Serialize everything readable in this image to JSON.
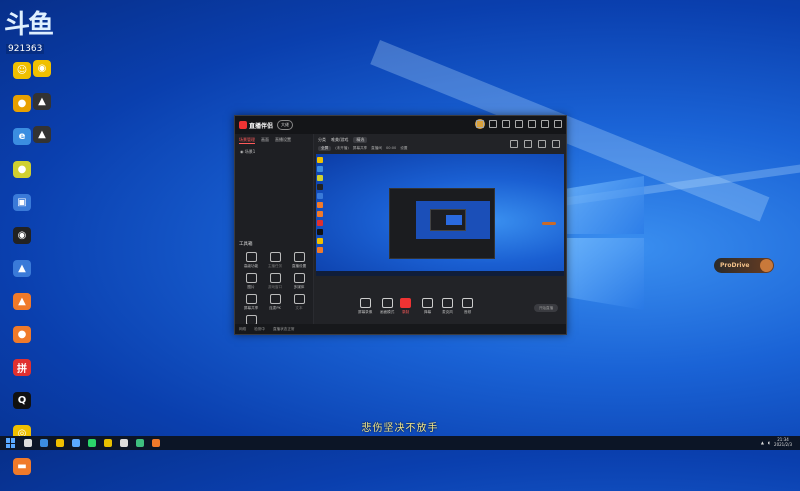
{
  "desktop": {
    "top_logo_text": "斗鱼",
    "top_logo_number": "921363",
    "icons": [
      {
        "label": "",
        "color": "#f0c000",
        "glyph": "☺"
      },
      {
        "label": "",
        "color": "#e8a000",
        "glyph": "●"
      },
      {
        "label": "",
        "color": "#3b8de0",
        "glyph": "e"
      },
      {
        "label": "",
        "color": "#d0d030",
        "glyph": "●"
      },
      {
        "label": "",
        "color": "#3a7ad8",
        "glyph": "▣"
      },
      {
        "label": "",
        "color": "#222222",
        "glyph": "◉"
      },
      {
        "label": "",
        "color": "#3a7ad8",
        "glyph": "▲"
      },
      {
        "label": "",
        "color": "#f07a2a",
        "glyph": "▲"
      },
      {
        "label": "",
        "color": "#f07a2a",
        "glyph": "●"
      },
      {
        "label": "",
        "color": "#e03030",
        "glyph": "拼"
      },
      {
        "label": "",
        "color": "#111111",
        "glyph": "Q"
      },
      {
        "label": "",
        "color": "#f0c000",
        "glyph": "◎"
      },
      {
        "label": "",
        "color": "#f07a2a",
        "glyph": "▬"
      }
    ],
    "icons_col2": [
      {
        "label": "",
        "color": "#f0c000",
        "glyph": "◉"
      },
      {
        "label": "",
        "color": "#333333",
        "glyph": "▲"
      },
      {
        "label": "",
        "color": "#333333",
        "glyph": "▲"
      }
    ]
  },
  "app": {
    "title": "直播伴侣",
    "badge": "大佬",
    "left_tabs": [
      "场景管理",
      "画面",
      "直播设置"
    ],
    "scene": "场景1",
    "tool_title": "工具箱",
    "tools": [
      {
        "label": "高级功能",
        "dim": false
      },
      {
        "label": "主播任务",
        "dim": true
      },
      {
        "label": "直播设置",
        "dim": false
      },
      {
        "label": "图片",
        "dim": false
      },
      {
        "label": "游戏窗口",
        "dim": true
      },
      {
        "label": "多媒体",
        "dim": false
      },
      {
        "label": "屏幕共享",
        "dim": false
      },
      {
        "label": "连麦PK",
        "dim": false
      },
      {
        "label": "文本",
        "dim": true
      },
      {
        "label": "工作一览",
        "dim": false
      }
    ],
    "main_tabs": [
      "分类",
      "唯美/游戏",
      "精选"
    ],
    "main_row2": [
      "全屏",
      "(未开播)",
      "屏幕共享",
      "直播间",
      "00:00",
      "设置"
    ],
    "controls": [
      {
        "label": "屏幕录像",
        "rec": false
      },
      {
        "label": "画面模式",
        "rec": false
      },
      {
        "label": "录制",
        "rec": true
      },
      {
        "label": "弹幕",
        "rec": false
      },
      {
        "label": "麦克风",
        "rec": false
      },
      {
        "label": "音频",
        "rec": false
      }
    ],
    "start_live": "开始直播",
    "status_items": [
      "网络",
      "检测中",
      "直播状态正常"
    ]
  },
  "prodrive_text": "ProDrive",
  "subtitle": "悲伤坚决不放手",
  "taskbar": {
    "time": "21:34",
    "date": "2021/2/3",
    "icon_colors": [
      "#dddddd",
      "#3b8de0",
      "#f0c000",
      "#5aa9ff",
      "#2bd56a",
      "#e8c000",
      "#dddddd",
      "#3fbf7f",
      "#f07a2a"
    ]
  }
}
